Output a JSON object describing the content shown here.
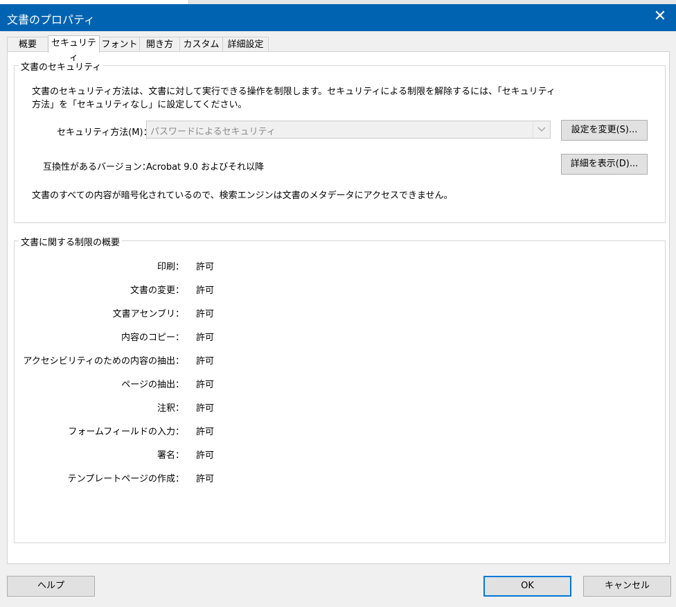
{
  "window": {
    "title": "文書のプロパティ",
    "close_glyph": "✕"
  },
  "tabs": [
    {
      "label": "概要"
    },
    {
      "label": "セキュリティ"
    },
    {
      "label": "フォント"
    },
    {
      "label": "開き方"
    },
    {
      "label": "カスタム"
    },
    {
      "label": "詳細設定"
    }
  ],
  "security": {
    "legend": "文書のセキュリティ",
    "description_line1": "文書のセキュリティ方法は、文書に対して実行できる操作を制限します。セキュリティによる制限を解除するには、「セキュリティ",
    "description_line2": "方法」を「セキュリティなし」に設定してください。",
    "method_label": "セキュリティ方法(M)：",
    "method_value": "パスワードによるセキュリティ",
    "change_button": "設定を変更(S)...",
    "compat_label": "互換性があるバージョン：",
    "compat_value": "Acrobat 9.0 およびそれ以降",
    "details_button": "詳細を表示(D)...",
    "encryption_note": "文書のすべての内容が暗号化されているので、検索エンジンは文書のメタデータにアクセスできません。"
  },
  "restrictions": {
    "legend": "文書に関する制限の概要",
    "rows": [
      {
        "label": "印刷：",
        "value": "許可"
      },
      {
        "label": "文書の変更：",
        "value": "許可"
      },
      {
        "label": "文書アセンブリ：",
        "value": "許可"
      },
      {
        "label": "内容のコピー：",
        "value": "許可"
      },
      {
        "label": "アクセシビリティのための内容の抽出：",
        "value": "許可"
      },
      {
        "label": "ページの抽出：",
        "value": "許可"
      },
      {
        "label": "注釈：",
        "value": "許可"
      },
      {
        "label": "フォームフィールドの入力：",
        "value": "許可"
      },
      {
        "label": "署名：",
        "value": "許可"
      },
      {
        "label": "テンプレートページの作成：",
        "value": "許可"
      }
    ]
  },
  "footer": {
    "help_button": "ヘルプ",
    "ok_button": "OK",
    "cancel_button": "キャンセル"
  },
  "colors": {
    "titlebar": "#0063b1",
    "default_button_border": "#0078d7"
  }
}
